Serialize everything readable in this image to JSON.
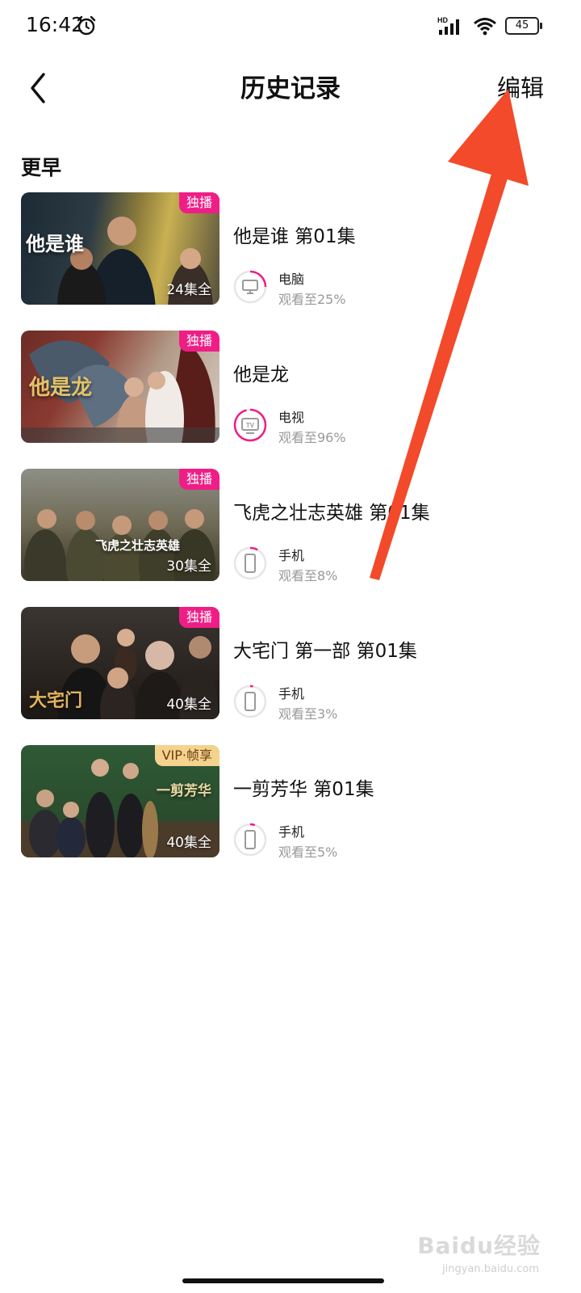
{
  "status_bar": {
    "time": "16:42",
    "network_label": "HD",
    "battery": "45"
  },
  "nav": {
    "title": "历史记录",
    "edit_label": "编辑"
  },
  "section": {
    "label": "更早"
  },
  "items": [
    {
      "title": "他是谁 第01集",
      "badge": "独播",
      "episodes": "24集全",
      "poster_text": "他是谁",
      "device": "电脑",
      "device_icon": "computer-icon",
      "progress_text": "观看至25%",
      "progress": 0.25
    },
    {
      "title": "他是龙",
      "badge": "独播",
      "episodes": "",
      "poster_text": "他是龙",
      "device": "电视",
      "device_icon": "tv-icon",
      "progress_text": "观看至96%",
      "progress": 0.96
    },
    {
      "title": "飞虎之壮志英雄 第01集",
      "badge": "独播",
      "episodes": "30集全",
      "poster_text": "飞虎之壮志英雄",
      "device": "手机",
      "device_icon": "phone-icon",
      "progress_text": "观看至8%",
      "progress": 0.08
    },
    {
      "title": "大宅门 第一部 第01集",
      "badge": "独播",
      "episodes": "40集全",
      "poster_text": "大宅门",
      "device": "手机",
      "device_icon": "phone-icon",
      "progress_text": "观看至3%",
      "progress": 0.03
    },
    {
      "title": "一剪芳华 第01集",
      "badge": "VIP·帧享",
      "episodes": "40集全",
      "poster_text": "一剪芳华",
      "device": "手机",
      "device_icon": "phone-icon",
      "progress_text": "观看至5%",
      "progress": 0.05
    }
  ],
  "colors": {
    "accent": "#ef1e86",
    "arrow": "#f24a2a",
    "vip_badge": "#f4d38f"
  },
  "watermark": {
    "text": "Baidu经验",
    "sub": "jingyan.baidu.com"
  }
}
